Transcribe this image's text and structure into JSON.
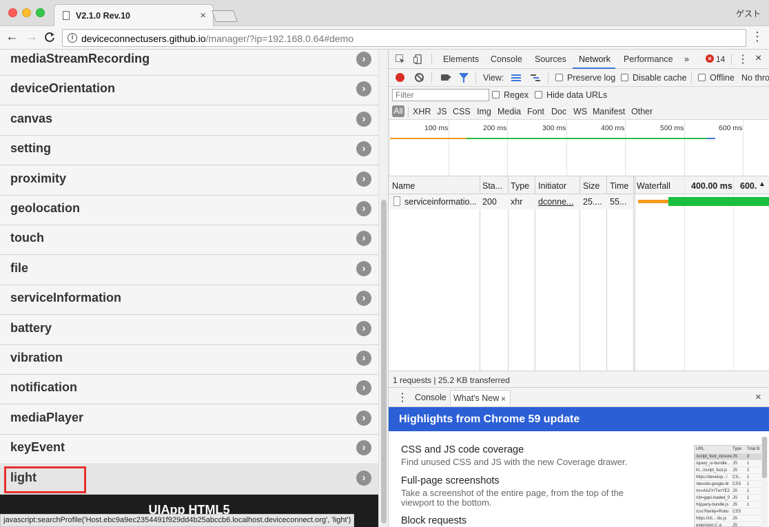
{
  "browser": {
    "tab_title": "V2.1.0 Rev.10",
    "tab_close": "×",
    "profile": "ゲスト",
    "url_host": "deviceconnectusers.github.io",
    "url_path": "/manager/?ip=192.168.0.64#demo",
    "back": "←",
    "forward": "→",
    "reload": "C",
    "menu": "⋮",
    "info": "i"
  },
  "page": {
    "items": [
      {
        "label": "mediaStreamRecording"
      },
      {
        "label": "deviceOrientation"
      },
      {
        "label": "canvas"
      },
      {
        "label": "setting"
      },
      {
        "label": "proximity"
      },
      {
        "label": "geolocation"
      },
      {
        "label": "touch"
      },
      {
        "label": "file"
      },
      {
        "label": "serviceInformation"
      },
      {
        "label": "battery"
      },
      {
        "label": "vibration"
      },
      {
        "label": "notification"
      },
      {
        "label": "mediaPlayer"
      },
      {
        "label": "keyEvent"
      },
      {
        "label": "light"
      }
    ],
    "arrow": "›",
    "footer_title": "UIApp HTML5",
    "status_text": "javascript:searchProfile('Host.ebc9a9ec2354491f929dd4b25abccb6.localhost.deviceconnect.org', 'light')"
  },
  "devtools": {
    "tabs": [
      "Elements",
      "Console",
      "Sources",
      "Network",
      "Performance"
    ],
    "selected_tab": "Network",
    "more": "»",
    "error_count": "14",
    "error_icon": "×",
    "menu": "⋮",
    "close": "×",
    "toolbar": {
      "view_label": "View:",
      "preserve_log": "Preserve log",
      "disable_cache": "Disable cache",
      "offline": "Offline",
      "throttling": "No throt"
    },
    "filter": {
      "placeholder": "Filter",
      "regex": "Regex",
      "hide_data_urls": "Hide data URLs"
    },
    "types": [
      "All",
      "XHR",
      "JS",
      "CSS",
      "Img",
      "Media",
      "Font",
      "Doc",
      "WS",
      "Manifest",
      "Other"
    ],
    "overview_ticks": [
      "100 ms",
      "200 ms",
      "300 ms",
      "400 ms",
      "500 ms",
      "600 ms"
    ],
    "columns": {
      "name": "Name",
      "status": "Sta...",
      "type": "Type",
      "initiator": "Initiator",
      "size": "Size",
      "time": "Time",
      "waterfall": "Waterfall",
      "wf_400": "400.00 ms",
      "wf_600": "600.",
      "sort": "▲"
    },
    "request": {
      "name": "serviceinformatio...",
      "status": "200",
      "type": "xhr",
      "initiator": "dconne...",
      "size": "25....",
      "time": "55..."
    },
    "summary": "1 requests | 25.2 KB transferred",
    "drawer": {
      "menu": "⋮",
      "console_tab": "Console",
      "whatsnew_tab": "What's New",
      "tab_close": "×",
      "close": "×"
    },
    "whats_new": {
      "banner": "Highlights from Chrome 59 update",
      "items": [
        {
          "title": "CSS and JS code coverage",
          "desc": "Find unused CSS and JS with the new Coverage drawer."
        },
        {
          "title": "Full-page screenshots",
          "desc": "Take a screenshot of the entire page, from the top of the viewport to the bottom."
        },
        {
          "title": "Block requests",
          "desc": ""
        }
      ],
      "thumb_header": [
        "URL",
        "Type",
        "Total B"
      ],
      "thumb_rows": [
        [
          "/script_foot_closure",
          "JS",
          "3"
        ],
        [
          "/query_ui-bundle...",
          "JS",
          "1"
        ],
        [
          "ht.../script_foot.js",
          "JS",
          "2"
        ],
        [
          "https://develop.../",
          "CS...",
          "1"
        ],
        [
          "/devsite-google-bl",
          "CSS",
          "1"
        ],
        [
          "/rs=AA2YrTvnYE2",
          "JS",
          "1"
        ],
        [
          "/cb=gapi.loaded_0",
          "JS",
          "1"
        ],
        [
          "h/jquery-bundle.js",
          "JS",
          "1"
        ],
        [
          "/css?family=Robo",
          "CSS",
          ""
        ],
        [
          "https://cli... /dc.js",
          "JS",
          ""
        ],
        [
          "extension://..e",
          "JS",
          ""
        ]
      ]
    }
  }
}
